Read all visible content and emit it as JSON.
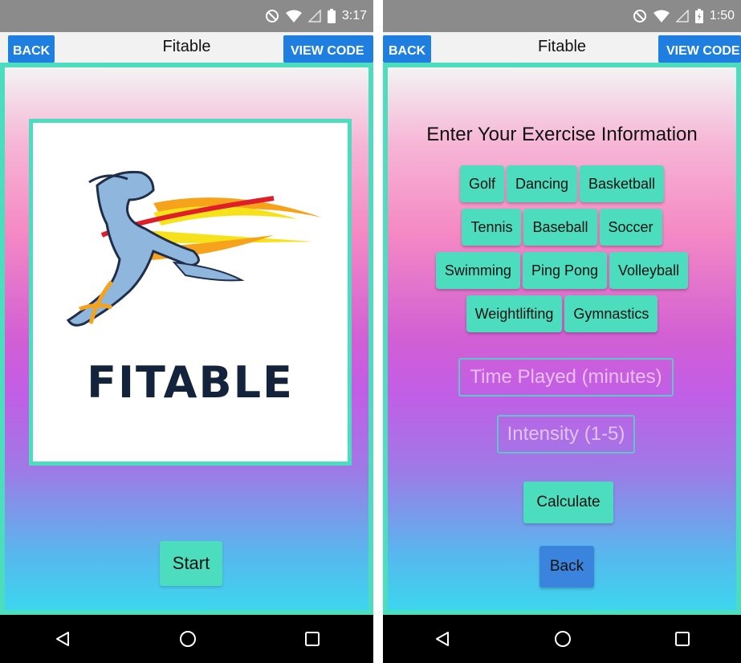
{
  "left_screen": {
    "status_bar": {
      "time": "3:17"
    },
    "header": {
      "back_label": "BACK",
      "title": "Fitable",
      "view_code_label": "VIEW CODE"
    },
    "logo": {
      "text": "FITABLE"
    },
    "start_label": "Start"
  },
  "right_screen": {
    "status_bar": {
      "time": "1:50"
    },
    "header": {
      "back_label": "BACK",
      "title": "Fitable",
      "view_code_label": "VIEW CODE"
    },
    "heading": "Enter Your Exercise Information",
    "sports_rows": [
      [
        "Golf",
        "Dancing",
        "Basketball"
      ],
      [
        "Tennis",
        "Baseball",
        "Soccer"
      ],
      [
        "Swimming",
        "Ping Pong",
        "Volleyball"
      ],
      [
        "Weightlifting",
        "Gymnastics"
      ]
    ],
    "time_placeholder": "Time Played (minutes)",
    "intensity_placeholder": "Intensity (1-5)",
    "calculate_label": "Calculate",
    "back_label": "Back"
  },
  "colors": {
    "accent": "#4cdcbe",
    "header_button": "#1f7fe0",
    "back_button": "#3b84de",
    "status_bar": "#8b8b8b"
  },
  "icons": [
    "do-not-disturb-icon",
    "wifi-icon",
    "signal-icon",
    "battery-icon",
    "nav-back-icon",
    "nav-home-icon",
    "nav-recents-icon"
  ]
}
